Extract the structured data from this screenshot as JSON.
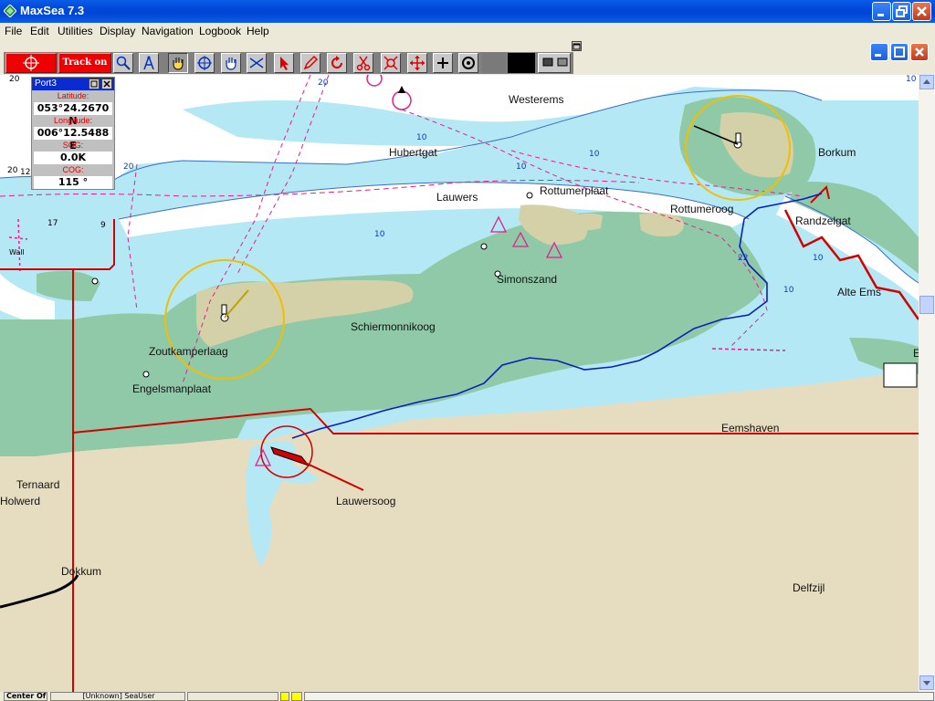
{
  "app": {
    "title": "MaxSea 7.3"
  },
  "menu": [
    "File",
    "Edit",
    "Utilities",
    "Display",
    "Navigation",
    "Logbook",
    "Help"
  ],
  "toolbar": {
    "track_label": "Track on",
    "tools": [
      "zoom-icon",
      "compass-icon",
      "hand-icon",
      "crosshair-icon",
      "pan-hand-icon",
      "route-icon",
      "pointer-icon",
      "pencil-icon",
      "rotate-icon",
      "scissors-icon",
      "target-icon",
      "move-icon",
      "plus-icon",
      "circle-target-icon"
    ]
  },
  "port_panel": {
    "title": "Port3",
    "latitude_label": "Latitude:",
    "latitude_value": "053°24.2670 N",
    "longitude_label": "Longitude:",
    "longitude_value": "006°12.5488 E",
    "sog_label": "SOG:",
    "sog_value": "0.0K",
    "cog_label": "COG:",
    "cog_value": "115 °"
  },
  "map": {
    "places": {
      "westerems": "Westerems",
      "hubertgat": "Hubertgat",
      "borkum": "Borkum",
      "lauwers": "Lauwers",
      "rottumerplaat": "Rottumerplaat",
      "rottumeroog": "Rottumeroog",
      "randzelgat": "Randzelgat",
      "simonszand": "Simonszand",
      "alte_ems": "Alte Ems",
      "schiermonnikoog": "Schiermonnikoog",
      "zoutkamperlaag": "Zoutkamperlaag",
      "engelsmanplaat": "Engelsmanplaat",
      "eemshaven": "Eemshaven",
      "ternaard": "Ternaard",
      "holwerd": "Holwerd",
      "lauwersoog": "Lauwersoog",
      "dokkum": "Dokkum",
      "delfzijl": "Delfzijl",
      "e_edge": "E",
      "wall": "Wall"
    },
    "depths": {
      "d20_a": "20",
      "d10_a": "10",
      "d10_b": "10",
      "d10_c": "10",
      "d20_b": "20",
      "d10_d": "10",
      "d10_e": "10",
      "d10_f": "10",
      "d20_c": "20",
      "d17": "17",
      "d12": "12",
      "d9": "9",
      "d20_d": "20",
      "d22": "22",
      "d10_g": "10"
    }
  },
  "status": {
    "cell1": "Center Of",
    "cell2": "[Unknown] SeaUser"
  },
  "colors": {
    "deep_water": "#ffffff",
    "shallow_water": "#b4e8f4",
    "drying": "#90c9a8",
    "land": "#e6ddc0",
    "sand": "#d4d0a8",
    "track": "#0a1fb8",
    "boundary": "#d40000",
    "range_ring": "#f0c000"
  }
}
